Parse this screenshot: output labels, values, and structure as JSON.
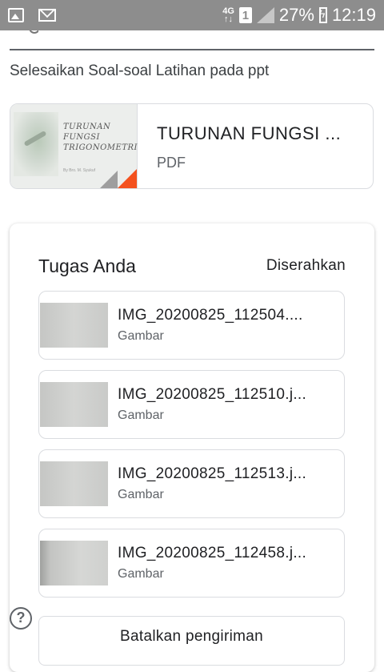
{
  "status_bar": {
    "network": "4G",
    "sim": "1",
    "battery": "27%",
    "time": "12:19",
    "icons": [
      "image-icon",
      "mail-icon",
      "signal-icon",
      "battery-icon"
    ]
  },
  "instruction": "Selesaikan Soal-soal Latihan pada ppt",
  "attachment": {
    "title": "TURUNAN FUNGSI ...",
    "type": "PDF",
    "thumb_lines": [
      "TURUNAN",
      "FUNGSI",
      "TRIGONOMETRI"
    ],
    "thumb_sub": "By Bro. M. Syukuf"
  },
  "your_work": {
    "heading": "Tugas Anda",
    "status": "Diserahkan",
    "files": [
      {
        "name": "IMG_20200825_112504....",
        "type": "Gambar"
      },
      {
        "name": "IMG_20200825_112510.j...",
        "type": "Gambar"
      },
      {
        "name": "IMG_20200825_112513.j...",
        "type": "Gambar"
      },
      {
        "name": "IMG_20200825_112458.j...",
        "type": "Gambar"
      }
    ],
    "unsubmit_label": "Batalkan pengiriman"
  },
  "help_label": "?",
  "colors": {
    "status_bar": "#8d8d8d",
    "pdf_corner": "#f4511e",
    "border": "#dadce0"
  }
}
